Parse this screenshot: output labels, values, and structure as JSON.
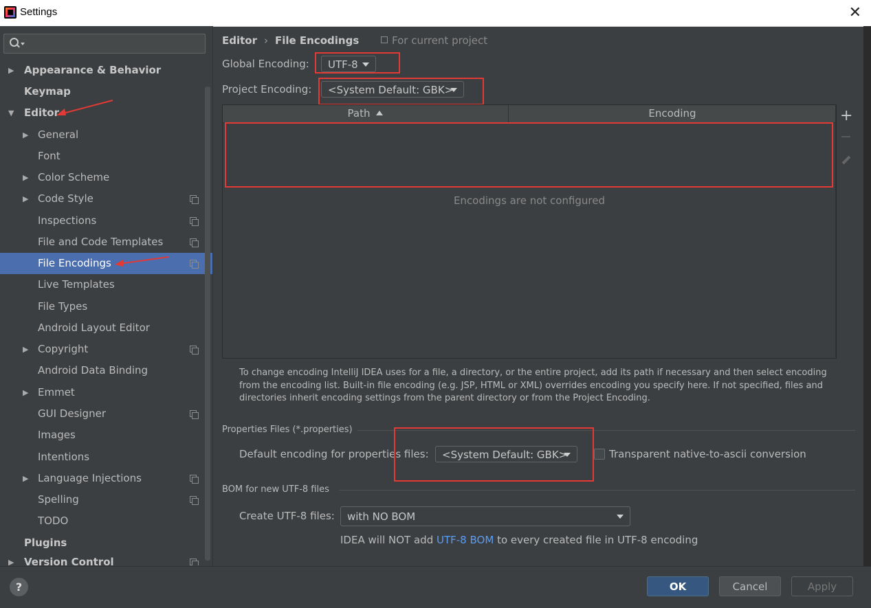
{
  "window": {
    "title": "Settings"
  },
  "search": {
    "placeholder": ""
  },
  "sidebar": {
    "items": [
      {
        "label": "Appearance & Behavior"
      },
      {
        "label": "Keymap"
      },
      {
        "label": "Editor"
      },
      {
        "label": "General"
      },
      {
        "label": "Font"
      },
      {
        "label": "Color Scheme"
      },
      {
        "label": "Code Style"
      },
      {
        "label": "Inspections"
      },
      {
        "label": "File and Code Templates"
      },
      {
        "label": "File Encodings"
      },
      {
        "label": "Live Templates"
      },
      {
        "label": "File Types"
      },
      {
        "label": "Android Layout Editor"
      },
      {
        "label": "Copyright"
      },
      {
        "label": "Android Data Binding"
      },
      {
        "label": "Emmet"
      },
      {
        "label": "GUI Designer"
      },
      {
        "label": "Images"
      },
      {
        "label": "Intentions"
      },
      {
        "label": "Language Injections"
      },
      {
        "label": "Spelling"
      },
      {
        "label": "TODO"
      },
      {
        "label": "Plugins"
      },
      {
        "label": "Version Control"
      }
    ]
  },
  "breadcrumb": {
    "parent": "Editor",
    "separator": "›",
    "current": "File Encodings",
    "scope": "For current project"
  },
  "global_encoding": {
    "label": "Global Encoding:",
    "value": "UTF-8"
  },
  "project_encoding": {
    "label": "Project Encoding:",
    "value": "<System Default: GBK>"
  },
  "table": {
    "columns": [
      "Path",
      "Encoding"
    ],
    "empty_text": "Encodings are not configured",
    "add_label": "+"
  },
  "description": "To change encoding IntelliJ IDEA uses for a file, a directory, or the entire project, add its path if necessary and then select encoding from the encoding list. Built-in file encoding (e.g. JSP, HTML or XML) overrides encoding you specify here. If not specified, files and directories inherit encoding settings from the parent directory or from the Project Encoding.",
  "properties": {
    "group_title": "Properties Files (*.properties)",
    "default_label": "Default encoding for properties files:",
    "default_value": "<System Default: GBK>",
    "transparent_label": "Transparent native-to-ascii conversion",
    "transparent_checked": false
  },
  "bom": {
    "group_title": "BOM for new UTF-8 files",
    "create_label": "Create UTF-8 files:",
    "create_value": "with NO BOM",
    "hint_prefix": "IDEA will NOT add",
    "hint_link": "UTF-8 BOM",
    "hint_suffix": "to every created file in UTF-8 encoding"
  },
  "footer": {
    "help": "?",
    "ok": "OK",
    "cancel": "Cancel",
    "apply": "Apply"
  },
  "colors": {
    "selection": "#4b6eaf",
    "annotation_red": "#e53935",
    "link": "#589df6"
  }
}
